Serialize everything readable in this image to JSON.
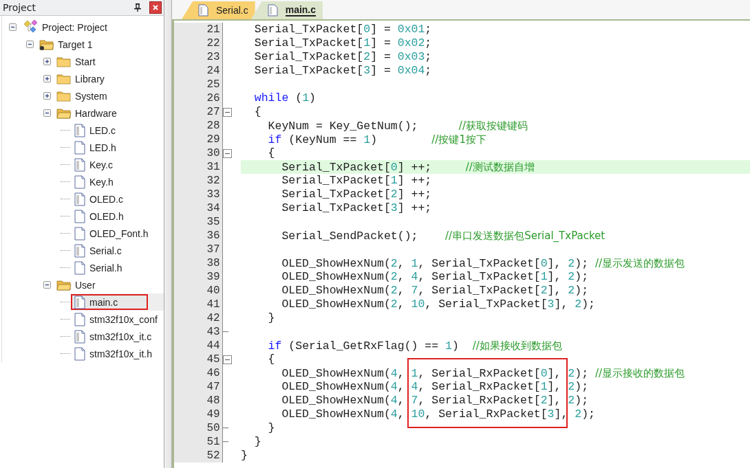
{
  "panel": {
    "title": "Project"
  },
  "tree": [
    {
      "kind": "project",
      "label": "Project: Project",
      "expanded": true,
      "selected": false,
      "framed": false,
      "children": [
        {
          "kind": "target",
          "label": "Target 1",
          "expanded": true,
          "selected": false,
          "framed": false,
          "children": [
            {
              "kind": "group",
              "label": "Start",
              "expanded": false,
              "selected": false,
              "framed": false
            },
            {
              "kind": "group",
              "label": "Library",
              "expanded": false,
              "selected": false,
              "framed": false
            },
            {
              "kind": "group",
              "label": "System",
              "expanded": false,
              "selected": false,
              "framed": false
            },
            {
              "kind": "group",
              "label": "Hardware",
              "expanded": true,
              "selected": false,
              "framed": false,
              "children": [
                {
                  "kind": "source",
                  "label": "LED.c",
                  "selected": false,
                  "framed": false
                },
                {
                  "kind": "header",
                  "label": "LED.h",
                  "selected": false,
                  "framed": false
                },
                {
                  "kind": "source",
                  "label": "Key.c",
                  "selected": false,
                  "framed": false
                },
                {
                  "kind": "header",
                  "label": "Key.h",
                  "selected": false,
                  "framed": false
                },
                {
                  "kind": "source",
                  "label": "OLED.c",
                  "selected": false,
                  "framed": false
                },
                {
                  "kind": "header",
                  "label": "OLED.h",
                  "selected": false,
                  "framed": false
                },
                {
                  "kind": "header",
                  "label": "OLED_Font.h",
                  "selected": false,
                  "framed": false
                },
                {
                  "kind": "source",
                  "label": "Serial.c",
                  "selected": false,
                  "framed": false
                },
                {
                  "kind": "header",
                  "label": "Serial.h",
                  "selected": false,
                  "framed": false
                }
              ]
            },
            {
              "kind": "group",
              "label": "User",
              "expanded": true,
              "selected": false,
              "framed": false,
              "children": [
                {
                  "kind": "source",
                  "label": "main.c",
                  "selected": true,
                  "framed": true
                },
                {
                  "kind": "header",
                  "label": "stm32f10x_conf",
                  "selected": false,
                  "framed": false
                },
                {
                  "kind": "source",
                  "label": "stm32f10x_it.c",
                  "selected": false,
                  "framed": false
                },
                {
                  "kind": "header",
                  "label": "stm32f10x_it.h",
                  "selected": false,
                  "framed": false
                }
              ]
            }
          ]
        }
      ]
    }
  ],
  "tabs": [
    {
      "label": "Serial.c",
      "selected": false
    },
    {
      "label": "main.c",
      "selected": true
    }
  ],
  "lines": [
    {
      "num": "21",
      "current": false,
      "boxed": false,
      "segments": [
        {
          "kind": "plain",
          "text": "  Serial_TxPacket["
        },
        {
          "kind": "number",
          "text": "0"
        },
        {
          "kind": "plain",
          "text": "] = "
        },
        {
          "kind": "number",
          "text": "0x01"
        },
        {
          "kind": "plain",
          "text": ";"
        }
      ]
    },
    {
      "num": "22",
      "current": false,
      "boxed": false,
      "segments": [
        {
          "kind": "plain",
          "text": "  Serial_TxPacket["
        },
        {
          "kind": "number",
          "text": "1"
        },
        {
          "kind": "plain",
          "text": "] = "
        },
        {
          "kind": "number",
          "text": "0x02"
        },
        {
          "kind": "plain",
          "text": ";"
        }
      ]
    },
    {
      "num": "23",
      "current": false,
      "boxed": false,
      "segments": [
        {
          "kind": "plain",
          "text": "  Serial_TxPacket["
        },
        {
          "kind": "number",
          "text": "2"
        },
        {
          "kind": "plain",
          "text": "] = "
        },
        {
          "kind": "number",
          "text": "0x03"
        },
        {
          "kind": "plain",
          "text": ";"
        }
      ]
    },
    {
      "num": "24",
      "current": false,
      "boxed": false,
      "segments": [
        {
          "kind": "plain",
          "text": "  Serial_TxPacket["
        },
        {
          "kind": "number",
          "text": "3"
        },
        {
          "kind": "plain",
          "text": "] = "
        },
        {
          "kind": "number",
          "text": "0x04"
        },
        {
          "kind": "plain",
          "text": ";"
        }
      ]
    },
    {
      "num": "25",
      "current": false,
      "boxed": false
    },
    {
      "num": "26",
      "current": false,
      "boxed": false,
      "segments": [
        {
          "kind": "keyword",
          "text": "  while"
        },
        {
          "kind": "plain",
          "text": " ("
        },
        {
          "kind": "number",
          "text": "1"
        },
        {
          "kind": "plain",
          "text": ")"
        }
      ]
    },
    {
      "num": "27",
      "current": false,
      "boxed": false,
      "fold_start": true,
      "segments": [
        {
          "kind": "plain",
          "text": "  {"
        }
      ]
    },
    {
      "num": "28",
      "current": false,
      "boxed": false,
      "segments": [
        {
          "kind": "plain",
          "text": "    KeyNum = Key_GetNum();      "
        },
        {
          "kind": "comment",
          "text": "//获取按键键码"
        }
      ]
    },
    {
      "num": "29",
      "current": false,
      "boxed": false,
      "segments": [
        {
          "kind": "keyword",
          "text": "    if"
        },
        {
          "kind": "plain",
          "text": " (KeyNum == "
        },
        {
          "kind": "number",
          "text": "1"
        },
        {
          "kind": "plain",
          "text": ")        "
        },
        {
          "kind": "comment",
          "text": "//按键1按下"
        }
      ]
    },
    {
      "num": "30",
      "current": false,
      "boxed": false,
      "fold_start": true,
      "segments": [
        {
          "kind": "plain",
          "text": "    {"
        }
      ]
    },
    {
      "num": "31",
      "current": true,
      "boxed": false,
      "segments": [
        {
          "kind": "plain",
          "text": "      Serial_TxPacket["
        },
        {
          "kind": "number",
          "text": "0"
        },
        {
          "kind": "plain",
          "text": "] ++;     "
        },
        {
          "kind": "comment",
          "text": "//测试数据自增"
        }
      ]
    },
    {
      "num": "32",
      "current": false,
      "boxed": false,
      "segments": [
        {
          "kind": "plain",
          "text": "      Serial_TxPacket["
        },
        {
          "kind": "number",
          "text": "1"
        },
        {
          "kind": "plain",
          "text": "] ++;"
        }
      ]
    },
    {
      "num": "33",
      "current": false,
      "boxed": false,
      "segments": [
        {
          "kind": "plain",
          "text": "      Serial_TxPacket["
        },
        {
          "kind": "number",
          "text": "2"
        },
        {
          "kind": "plain",
          "text": "] ++;"
        }
      ]
    },
    {
      "num": "34",
      "current": false,
      "boxed": false,
      "segments": [
        {
          "kind": "plain",
          "text": "      Serial_TxPacket["
        },
        {
          "kind": "number",
          "text": "3"
        },
        {
          "kind": "plain",
          "text": "] ++;"
        }
      ]
    },
    {
      "num": "35",
      "current": false,
      "boxed": false
    },
    {
      "num": "36",
      "current": false,
      "boxed": false,
      "segments": [
        {
          "kind": "plain",
          "text": "      Serial_SendPacket();    "
        },
        {
          "kind": "comment",
          "text": "//串口发送数据包Serial_TxPacket"
        }
      ]
    },
    {
      "num": "37",
      "current": false,
      "boxed": false
    },
    {
      "num": "38",
      "current": false,
      "boxed": false,
      "segments": [
        {
          "kind": "plain",
          "text": "      OLED_ShowHexNum("
        },
        {
          "kind": "number",
          "text": "2"
        },
        {
          "kind": "plain",
          "text": ", "
        },
        {
          "kind": "number",
          "text": "1"
        },
        {
          "kind": "plain",
          "text": ", Serial_TxPacket["
        },
        {
          "kind": "number",
          "text": "0"
        },
        {
          "kind": "plain",
          "text": "], "
        },
        {
          "kind": "number",
          "text": "2"
        },
        {
          "kind": "plain",
          "text": "); "
        },
        {
          "kind": "comment",
          "text": "//显示发送的数据包"
        }
      ]
    },
    {
      "num": "39",
      "current": false,
      "boxed": false,
      "segments": [
        {
          "kind": "plain",
          "text": "      OLED_ShowHexNum("
        },
        {
          "kind": "number",
          "text": "2"
        },
        {
          "kind": "plain",
          "text": ", "
        },
        {
          "kind": "number",
          "text": "4"
        },
        {
          "kind": "plain",
          "text": ", Serial_TxPacket["
        },
        {
          "kind": "number",
          "text": "1"
        },
        {
          "kind": "plain",
          "text": "], "
        },
        {
          "kind": "number",
          "text": "2"
        },
        {
          "kind": "plain",
          "text": ");"
        }
      ]
    },
    {
      "num": "40",
      "current": false,
      "boxed": false,
      "segments": [
        {
          "kind": "plain",
          "text": "      OLED_ShowHexNum("
        },
        {
          "kind": "number",
          "text": "2"
        },
        {
          "kind": "plain",
          "text": ", "
        },
        {
          "kind": "number",
          "text": "7"
        },
        {
          "kind": "plain",
          "text": ", Serial_TxPacket["
        },
        {
          "kind": "number",
          "text": "2"
        },
        {
          "kind": "plain",
          "text": "], "
        },
        {
          "kind": "number",
          "text": "2"
        },
        {
          "kind": "plain",
          "text": ");"
        }
      ]
    },
    {
      "num": "41",
      "current": false,
      "boxed": false,
      "segments": [
        {
          "kind": "plain",
          "text": "      OLED_ShowHexNum("
        },
        {
          "kind": "number",
          "text": "2"
        },
        {
          "kind": "plain",
          "text": ", "
        },
        {
          "kind": "number",
          "text": "10"
        },
        {
          "kind": "plain",
          "text": ", Serial_TxPacket["
        },
        {
          "kind": "number",
          "text": "3"
        },
        {
          "kind": "plain",
          "text": "], "
        },
        {
          "kind": "number",
          "text": "2"
        },
        {
          "kind": "plain",
          "text": ");"
        }
      ]
    },
    {
      "num": "42",
      "current": false,
      "boxed": false,
      "segments": [
        {
          "kind": "plain",
          "text": "    }"
        }
      ]
    },
    {
      "num": "43",
      "current": false,
      "boxed": false,
      "fold_end": true
    },
    {
      "num": "44",
      "current": false,
      "boxed": false,
      "segments": [
        {
          "kind": "keyword",
          "text": "    if"
        },
        {
          "kind": "plain",
          "text": " (Serial_GetRxFlag() == "
        },
        {
          "kind": "number",
          "text": "1"
        },
        {
          "kind": "plain",
          "text": ")  "
        },
        {
          "kind": "comment",
          "text": "//如果接收到数据包"
        }
      ]
    },
    {
      "num": "45",
      "current": false,
      "boxed": false,
      "fold_start": true,
      "segments": [
        {
          "kind": "plain",
          "text": "    {"
        }
      ]
    },
    {
      "num": "46",
      "current": false,
      "boxed": true,
      "segments": [
        {
          "kind": "plain",
          "text": "      OLED_ShowHexNum("
        },
        {
          "kind": "number",
          "text": "4"
        },
        {
          "kind": "plain",
          "text": ", "
        },
        {
          "kind": "number",
          "text": "1"
        },
        {
          "kind": "plain",
          "text": ", Serial_RxPacket["
        },
        {
          "kind": "number",
          "text": "0"
        },
        {
          "kind": "plain",
          "text": "], "
        },
        {
          "kind": "number",
          "text": "2"
        },
        {
          "kind": "plain",
          "text": "); "
        },
        {
          "kind": "comment",
          "text": "//显示接收的数据包"
        }
      ]
    },
    {
      "num": "47",
      "current": false,
      "boxed": true,
      "segments": [
        {
          "kind": "plain",
          "text": "      OLED_ShowHexNum("
        },
        {
          "kind": "number",
          "text": "4"
        },
        {
          "kind": "plain",
          "text": ", "
        },
        {
          "kind": "number",
          "text": "4"
        },
        {
          "kind": "plain",
          "text": ", Serial_RxPacket["
        },
        {
          "kind": "number",
          "text": "1"
        },
        {
          "kind": "plain",
          "text": "], "
        },
        {
          "kind": "number",
          "text": "2"
        },
        {
          "kind": "plain",
          "text": ");"
        }
      ]
    },
    {
      "num": "48",
      "current": false,
      "boxed": true,
      "segments": [
        {
          "kind": "plain",
          "text": "      OLED_ShowHexNum("
        },
        {
          "kind": "number",
          "text": "4"
        },
        {
          "kind": "plain",
          "text": ", "
        },
        {
          "kind": "number",
          "text": "7"
        },
        {
          "kind": "plain",
          "text": ", Serial_RxPacket["
        },
        {
          "kind": "number",
          "text": "2"
        },
        {
          "kind": "plain",
          "text": "], "
        },
        {
          "kind": "number",
          "text": "2"
        },
        {
          "kind": "plain",
          "text": ");"
        }
      ]
    },
    {
      "num": "49",
      "current": false,
      "boxed": true,
      "segments": [
        {
          "kind": "plain",
          "text": "      OLED_ShowHexNum("
        },
        {
          "kind": "number",
          "text": "4"
        },
        {
          "kind": "plain",
          "text": ", "
        },
        {
          "kind": "number",
          "text": "10"
        },
        {
          "kind": "plain",
          "text": ", Serial_RxPacket["
        },
        {
          "kind": "number",
          "text": "3"
        },
        {
          "kind": "plain",
          "text": "], "
        },
        {
          "kind": "number",
          "text": "2"
        },
        {
          "kind": "plain",
          "text": ");"
        }
      ]
    },
    {
      "num": "50",
      "current": false,
      "boxed": false,
      "fold_end": true,
      "segments": [
        {
          "kind": "plain",
          "text": "    }"
        }
      ]
    },
    {
      "num": "51",
      "current": false,
      "boxed": false,
      "fold_end": true,
      "segments": [
        {
          "kind": "plain",
          "text": "  }"
        }
      ]
    },
    {
      "num": "52",
      "current": false,
      "boxed": false,
      "segments": [
        {
          "kind": "plain",
          "text": "}"
        }
      ]
    }
  ]
}
